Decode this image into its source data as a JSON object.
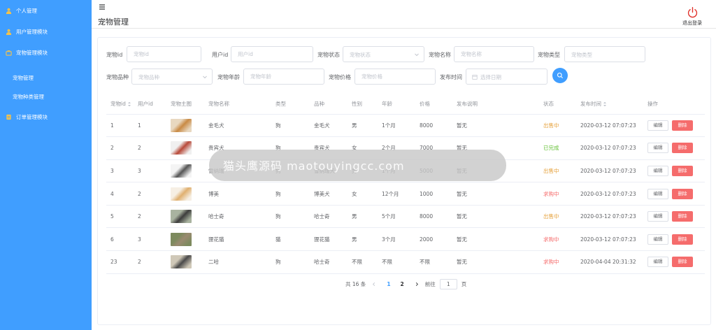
{
  "sidebar": {
    "items": [
      {
        "label": "个人管理",
        "icon": "user-icon"
      },
      {
        "label": "用户管理模块",
        "icon": "user-icon"
      },
      {
        "label": "宠物管理模块",
        "icon": "briefcase-icon"
      },
      {
        "label": "订单管理模块",
        "icon": "order-icon"
      }
    ],
    "sub_items": [
      {
        "label": "宠物管理"
      },
      {
        "label": "宠物种类管理"
      }
    ]
  },
  "header": {
    "page_title": "宠物管理",
    "logout_label": "退出登录"
  },
  "filters": {
    "pet_id": {
      "label": "宠物id",
      "placeholder": "宠物id"
    },
    "user_id": {
      "label": "用户id",
      "placeholder": "用户id"
    },
    "pet_status": {
      "label": "宠物状态",
      "placeholder": "宠物状态"
    },
    "pet_name": {
      "label": "宠物名称",
      "placeholder": "宠物名称"
    },
    "pet_type": {
      "label": "宠物类型",
      "placeholder": "宠物类型"
    },
    "pet_breed": {
      "label": "宠物品种",
      "placeholder": "宠物品种"
    },
    "pet_age": {
      "label": "宠物年龄",
      "placeholder": "宠物年龄"
    },
    "pet_price": {
      "label": "宠物价格",
      "placeholder": "宠物价格"
    },
    "publish_time": {
      "label": "发布时间",
      "placeholder": "选择日期"
    }
  },
  "table": {
    "columns": [
      "宠物id",
      "用户id",
      "宠物主图",
      "宠物名称",
      "类型",
      "品种",
      "性别",
      "年龄",
      "价格",
      "发布说明",
      "状态",
      "发布时间",
      "操作"
    ],
    "edit_label": "编辑",
    "delete_label": "删除",
    "rows": [
      {
        "pet_id": "1",
        "user_id": "1",
        "name": "金毛犬",
        "type": "狗",
        "breed": "金毛犬",
        "gender": "男",
        "age": "1个月",
        "price": "8000",
        "desc": "暂无",
        "status": "出售中",
        "status_class": "st-sale",
        "time": "2020-03-12 07:07:23",
        "thumb": [
          "#e8d8c0",
          "#c98a45"
        ]
      },
      {
        "pet_id": "2",
        "user_id": "2",
        "name": "贵宾犬",
        "type": "狗",
        "breed": "贵宾犬",
        "gender": "女",
        "age": "2个月",
        "price": "7000",
        "desc": "暂无",
        "status": "已完成",
        "status_class": "st-done",
        "time": "2020-03-12 07:07:23",
        "thumb": [
          "#f0f0f0",
          "#b84a3a"
        ]
      },
      {
        "pet_id": "3",
        "user_id": "3",
        "name": "雪纳瑞",
        "type": "狗",
        "breed": "雪纳瑞犬",
        "gender": "男",
        "age": "1个月",
        "price": "5000",
        "desc": "暂无",
        "status": "出售中",
        "status_class": "st-sale",
        "time": "2020-03-12 07:07:23",
        "thumb": [
          "#f4f4f4",
          "#555555"
        ]
      },
      {
        "pet_id": "4",
        "user_id": "2",
        "name": "博美",
        "type": "狗",
        "breed": "博美犬",
        "gender": "女",
        "age": "12个月",
        "price": "1000",
        "desc": "暂无",
        "status": "求购中",
        "status_class": "st-want",
        "time": "2020-03-12 07:07:23",
        "thumb": [
          "#f6efe4",
          "#e0b070"
        ]
      },
      {
        "pet_id": "5",
        "user_id": "2",
        "name": "哈士奇",
        "type": "狗",
        "breed": "哈士奇",
        "gender": "男",
        "age": "5个月",
        "price": "8000",
        "desc": "暂无",
        "status": "出售中",
        "status_class": "st-sale",
        "time": "2020-03-12 07:07:23",
        "thumb": [
          "#a9b3a0",
          "#3d3d3d"
        ]
      },
      {
        "pet_id": "6",
        "user_id": "3",
        "name": "狸花猫",
        "type": "猫",
        "breed": "狸花猫",
        "gender": "男",
        "age": "3个月",
        "price": "2000",
        "desc": "暂无",
        "status": "求购中",
        "status_class": "st-want",
        "time": "2020-03-12 07:07:23",
        "thumb": [
          "#7d8a5e",
          "#9a8a70"
        ]
      },
      {
        "pet_id": "23",
        "user_id": "2",
        "name": "二哈",
        "type": "狗",
        "breed": "哈士奇",
        "gender": "不限",
        "age": "不限",
        "price": "不限",
        "desc": "暂无",
        "status": "求购中",
        "status_class": "st-want",
        "time": "2020-04-04 20:31:32",
        "thumb": [
          "#cfc8b8",
          "#4a4a4a"
        ]
      }
    ]
  },
  "pagination": {
    "total_label": "共 16 条",
    "pages": [
      "1",
      "2"
    ],
    "current_page": "1",
    "goto_label": "前往",
    "goto_value": "1",
    "page_unit": "页"
  },
  "overlay": {
    "watermark_text": "猫头鹰源码 maotouyingcc.com"
  },
  "colors": {
    "sidebar_bg": "#409eff",
    "primary": "#409eff",
    "danger": "#f56c6c",
    "success": "#67c23a",
    "warning": "#e6a23c"
  }
}
